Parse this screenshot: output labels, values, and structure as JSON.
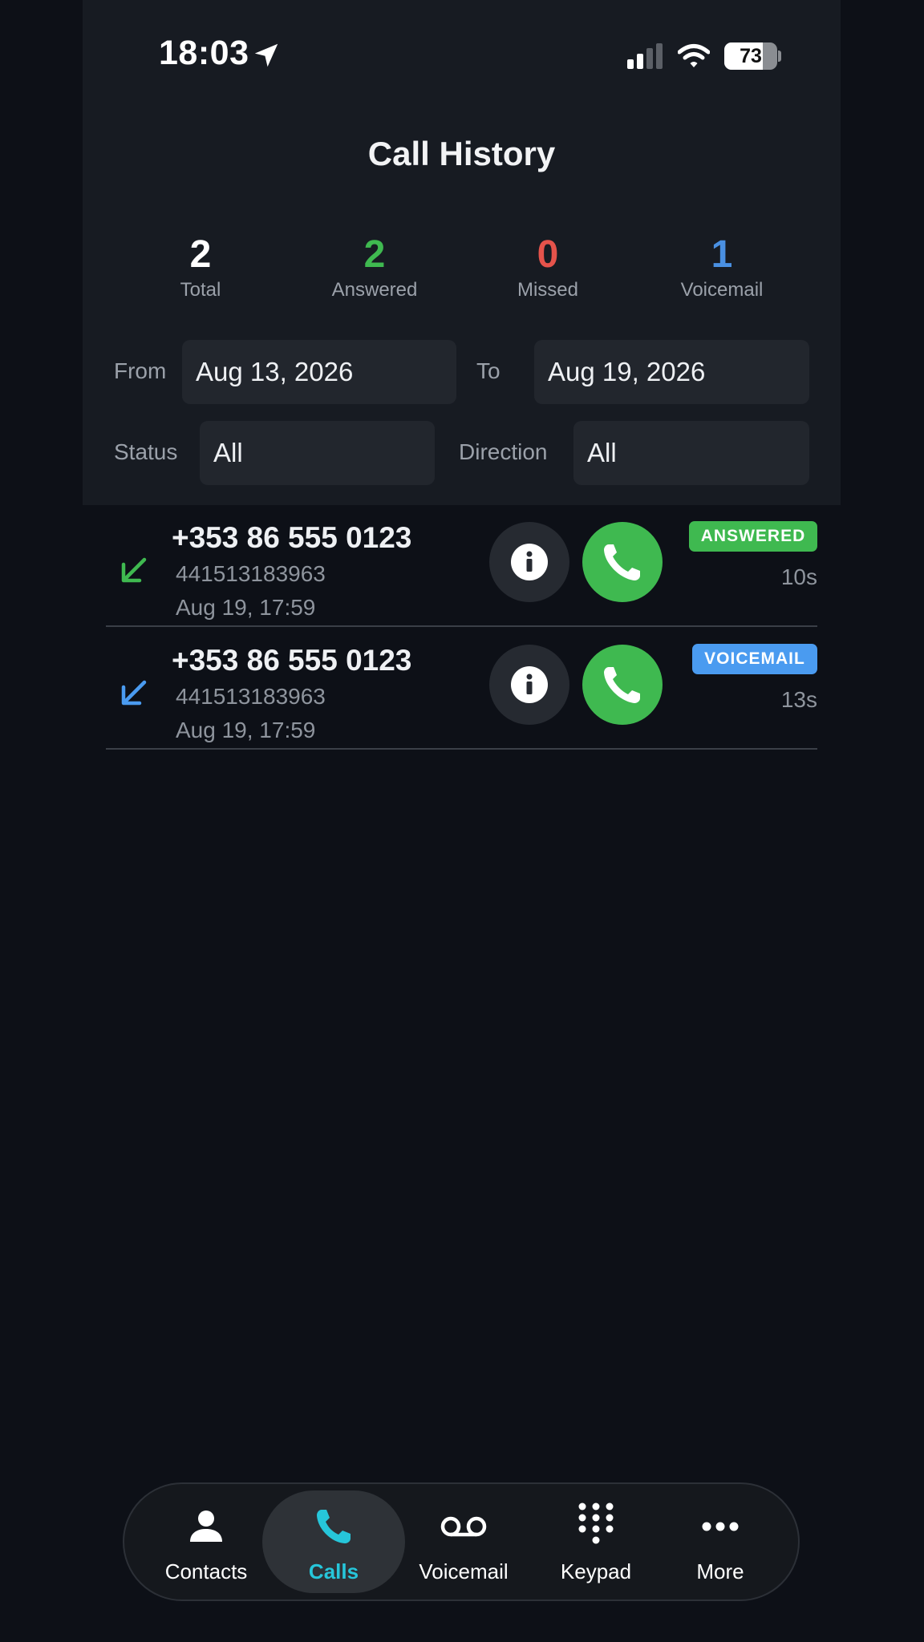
{
  "status_bar": {
    "time": "18:03",
    "battery": "73",
    "battery_level": 0.73
  },
  "header": {
    "title": "Call History"
  },
  "stats": [
    {
      "value": "2",
      "label": "Total",
      "color": "#ffffff"
    },
    {
      "value": "2",
      "label": "Answered",
      "color": "#3fb950"
    },
    {
      "value": "0",
      "label": "Missed",
      "color": "#e5534b"
    },
    {
      "value": "1",
      "label": "Voicemail",
      "color": "#4a90e2"
    }
  ],
  "filters": {
    "from_label": "From",
    "from_value": "Aug 13, 2026",
    "to_label": "To",
    "to_value": "Aug 19, 2026",
    "status_label": "Status",
    "status_value": "All",
    "direction_label": "Direction",
    "direction_value": "All"
  },
  "calls": [
    {
      "number": "+353 86 555 0123",
      "sub": "441513183963",
      "date": "Aug 19, 17:59",
      "badge": "ANSWERED",
      "badge_color": "#3fb950",
      "duration": "10s",
      "arrow_color": "#3fb950"
    },
    {
      "number": "+353 86 555 0123",
      "sub": "441513183963",
      "date": "Aug 19, 17:59",
      "badge": "VOICEMAIL",
      "badge_color": "#4a9bf0",
      "duration": "13s",
      "arrow_color": "#4a9bf0"
    }
  ],
  "nav": {
    "active_color": "#26c6da",
    "items": [
      {
        "label": "Contacts",
        "icon": "person-icon"
      },
      {
        "label": "Calls",
        "icon": "phone-icon"
      },
      {
        "label": "Voicemail",
        "icon": "voicemail-icon"
      },
      {
        "label": "Keypad",
        "icon": "keypad-icon"
      },
      {
        "label": "More",
        "icon": "more-icon"
      }
    ]
  }
}
